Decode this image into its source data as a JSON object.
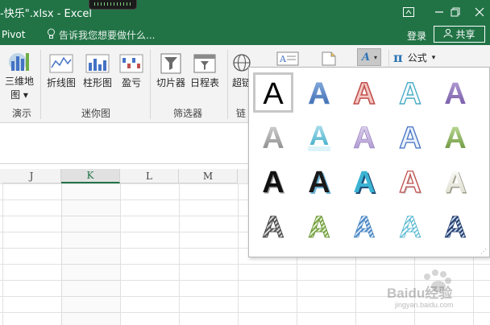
{
  "window": {
    "title": "-快乐\".xlsx - Excel",
    "controls": [
      "restore-ribbon",
      "minimize",
      "restore",
      "close"
    ]
  },
  "tabs": {
    "pivot": "Pivot",
    "tell_me": "告诉我您想要做什么..."
  },
  "account": {
    "login": "登录",
    "share": "共享"
  },
  "ribbon": {
    "map3d": {
      "line1": "三维地",
      "line2": "图 ▾"
    },
    "sparkline_line": "折线图",
    "sparkline_column": "柱形图",
    "sparkline_winloss": "盈亏",
    "slicer": "切片器",
    "timeline": "日程表",
    "link_partial": "超链",
    "formula": "公式",
    "formula_arrow": "▾",
    "groups": {
      "tours": "演示",
      "sparklines": "迷你图",
      "filters": "筛选器",
      "links_partial": "链"
    }
  },
  "columns": [
    "J",
    "K",
    "L",
    "M"
  ],
  "selected_column": "K",
  "wordart_gallery": {
    "glyph": "A",
    "styles": [
      [
        "plain-black",
        "blue-gradient",
        "red-outline-pink",
        "cyan-outline",
        "purple-gradient"
      ],
      [
        "gray-gradient",
        "cyan-reflection",
        "lavender-gradient",
        "blue-outline",
        "green-gradient"
      ],
      [
        "black-shadow",
        "black-blue-shadow",
        "cyan-dark-shadow",
        "red-outline-white",
        "cream-shadow"
      ],
      [
        "gray-stripes",
        "green-stripes",
        "blue-stripes",
        "cyan-stripes",
        "navy-stripes"
      ]
    ]
  },
  "watermark": {
    "text": "Baidu经验",
    "url": "jingyan.baidu.com"
  }
}
